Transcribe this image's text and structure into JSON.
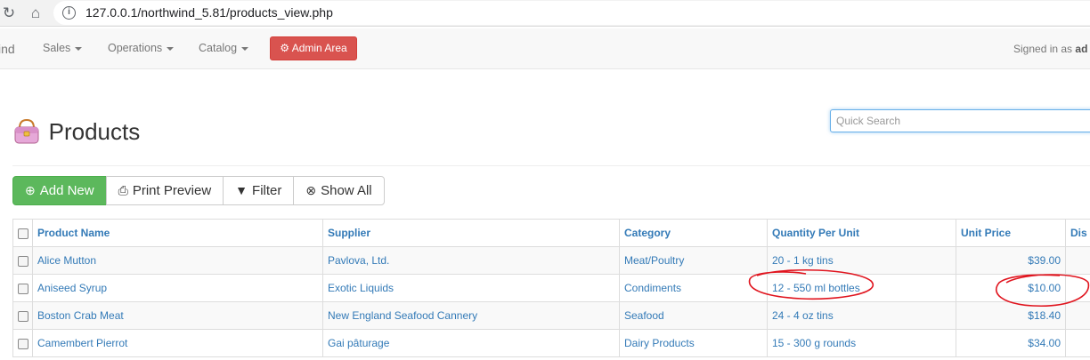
{
  "browser": {
    "url": "127.0.0.1/northwind_5.81/products_view.php"
  },
  "navbar": {
    "brand": "ind",
    "menus": [
      {
        "label": "Sales"
      },
      {
        "label": "Operations"
      },
      {
        "label": "Catalog"
      }
    ],
    "admin_label": "Admin Area",
    "signed_in_label": "Signed in as",
    "signed_in_user": "ad"
  },
  "page": {
    "title": "Products",
    "search_placeholder": "Quick Search"
  },
  "toolbar": {
    "add_new": "Add New",
    "print_preview": "Print Preview",
    "filter": "Filter",
    "show_all": "Show All"
  },
  "table": {
    "headers": [
      "Product Name",
      "Supplier",
      "Category",
      "Quantity Per Unit",
      "Unit Price",
      "Dis"
    ],
    "rows": [
      [
        "Alice Mutton",
        "Pavlova, Ltd.",
        "Meat/Poultry",
        "20 - 1 kg tins",
        "$39.00"
      ],
      [
        "Aniseed Syrup",
        "Exotic Liquids",
        "Condiments",
        "12 - 550 ml bottles",
        "$10.00"
      ],
      [
        "Boston Crab Meat",
        "New England Seafood Cannery",
        "Seafood",
        "24 - 4 oz tins",
        "$18.40"
      ],
      [
        "Camembert Pierrot",
        "Gai pâturage",
        "Dairy Products",
        "15 - 300 g rounds",
        "$34.00"
      ]
    ]
  },
  "colors": {
    "admin": "#d9534f",
    "success": "#5cb85c",
    "link": "#337ab7",
    "annotation": "#e0141e"
  }
}
